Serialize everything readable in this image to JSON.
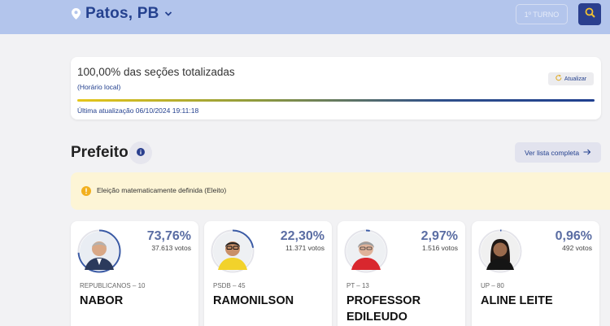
{
  "header": {
    "city": "Patos, PB",
    "turno_label": "1º TURNO"
  },
  "status": {
    "title": "100,00% das seções totalizadas",
    "subtitle": "(Horário local)",
    "refresh_label": "Atualizar",
    "progress_fraction": 1.0,
    "last_update": "Última atualização 06/10/2024 19:11:18"
  },
  "section": {
    "title": "Prefeito",
    "list_label": "Ver lista completa"
  },
  "alert": {
    "text": "Eleição matematicamente definida (Eleito)"
  },
  "candidates": [
    {
      "percent": "73,76%",
      "votes": "37.613 votos",
      "party": "REPUBLICANOS – 10",
      "name": "NABOR",
      "share": 0.7376
    },
    {
      "percent": "22,30%",
      "votes": "11.371 votos",
      "party": "PSDB – 45",
      "name": "RAMONILSON",
      "share": 0.223
    },
    {
      "percent": "2,97%",
      "votes": "1.516 votos",
      "party": "PT – 13",
      "name": "PROFESSOR EDILEUDO",
      "share": 0.0297
    },
    {
      "percent": "0,96%",
      "votes": "492 votos",
      "party": "UP – 80",
      "name": "ALINE LEITE",
      "share": 0.0096
    }
  ],
  "colors": {
    "header_bg": "#b3c5ec",
    "brand_blue": "#24418f",
    "alert_bg": "#fdf5d6",
    "alert_icon": "#f2b01e"
  },
  "icons": {
    "location": "location-pin-icon",
    "dropdown": "chevron-down-icon",
    "search": "search-icon",
    "refresh": "refresh-icon",
    "info": "info-icon",
    "arrow": "arrow-right-icon",
    "alert": "alert-icon"
  }
}
